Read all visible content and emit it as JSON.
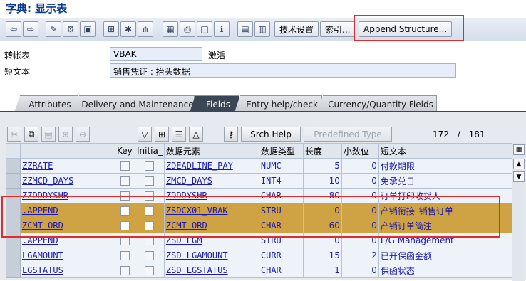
{
  "window": {
    "title": "字典: 显示表"
  },
  "toolbar": {
    "icons": [
      "back-icon",
      "forward-icon",
      "edit-icon",
      "tools-icon",
      "display-icon",
      "hierarchy-icon",
      "flash-icon",
      "network-icon",
      "grid-icon",
      "print-icon",
      "blank-icon",
      "info-icon",
      "layout-icon",
      "table-icon"
    ],
    "tech_settings": "技术设置",
    "index": "索引...",
    "append_structure": "Append Structure..."
  },
  "header": {
    "table_label": "转帐表",
    "table_value": "VBAK",
    "status": "激活",
    "short_text_label": "短文本",
    "short_text_value": "销售凭证 : 抬头数据"
  },
  "tabs": [
    "Attributes",
    "Delivery and Maintenance",
    "Fields",
    "Entry help/check",
    "Currency/Quantity Fields"
  ],
  "active_tab": "Fields",
  "table_toolbar": {
    "srch_help": "Srch Help",
    "predefined_type": "Predefined Type",
    "counter_current": "172",
    "counter_separator": "/",
    "counter_total": "181"
  },
  "columns": [
    "",
    "Key",
    "Initia_",
    "数据元素",
    "数据类型",
    "长度",
    "小数位",
    "短文本"
  ],
  "rows": [
    {
      "field": "ZZRATE",
      "key": false,
      "init": false,
      "element": "ZDEADLINE_PAY",
      "type": "NUMC",
      "length": "5",
      "decimals": "0",
      "text": "付款期限"
    },
    {
      "field": "ZZMCD_DAYS",
      "key": false,
      "init": false,
      "element": "ZMCD_DAYS",
      "type": "INT4",
      "length": "10",
      "decimals": "0",
      "text": "免承兑日"
    },
    {
      "field": "ZZDDDYSHR",
      "key": false,
      "init": false,
      "element": "ZDDDYSHR",
      "type": "CHAR",
      "length": "80",
      "decimals": "0",
      "text": "订单打印收货人"
    },
    {
      "field": ".APPEND",
      "key": false,
      "init": false,
      "element": "ZSDCX01_VBAK",
      "type": "STRU",
      "length": "0",
      "decimals": "0",
      "text": "产销衔接_销售订单"
    },
    {
      "field": "ZCMT_ORD",
      "key": false,
      "init": false,
      "element": "ZCMT_ORD",
      "type": "CHAR",
      "length": "60",
      "decimals": "0",
      "text": "产销订单简注"
    },
    {
      "field": ".APPEND",
      "key": false,
      "init": false,
      "element": "ZSD_LGM",
      "type": "STRU",
      "length": "0",
      "decimals": "0",
      "text": "L/G Management"
    },
    {
      "field": "LGAMOUNT",
      "key": false,
      "init": false,
      "element": "ZSD_LGAMOUNT",
      "type": "CURR",
      "length": "15",
      "decimals": "2",
      "text": "已开保函金额"
    },
    {
      "field": "LGSTATUS",
      "key": false,
      "init": false,
      "element": "ZSD_LGSTATUS",
      "type": "CHAR",
      "length": "1",
      "decimals": "0",
      "text": "保函状态"
    }
  ],
  "highlight_color": "#e32b2b",
  "selected_row_color": "#cfa244"
}
